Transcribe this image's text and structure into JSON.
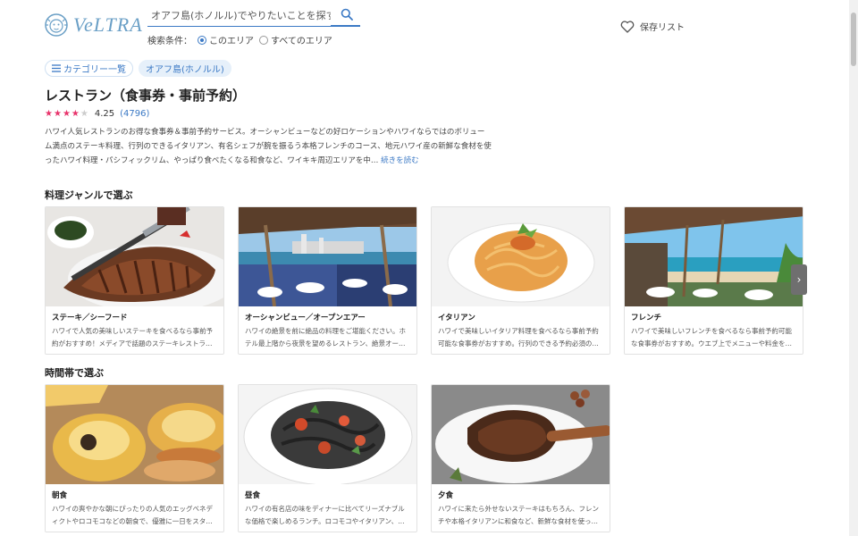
{
  "header": {
    "logo_text": "VeLTRA",
    "search_placeholder": "オアフ島(ホノルル)でやりたいことを探す",
    "search_condition_label": "検索条件：",
    "radio_this_area": "このエリア",
    "radio_all_areas": "すべてのエリア",
    "save_list_label": "保存リスト"
  },
  "chips": {
    "category_list": "カテゴリー一覧",
    "area": "オアフ島(ホノルル)"
  },
  "page": {
    "title": "レストラン（食事券・事前予約）",
    "rating_value": "4.25",
    "rating_stars": 4.25,
    "rating_count": "(4796)",
    "description": "ハワイ人気レストランのお得な食事券＆事前予約サービス。オーシャンビューなどの好ロケーションやハワイならではのボリューム満点のステーキ料理、行列のできるイタリアン、有名シェフが腕を振るう本格フレンチのコース、地元ハワイ産の新鮮な食材を使ったハワイ料理・パシフィックリム、やっぱり食べたくなる和食など、ワイキキ周辺エリアを中…",
    "read_more": "続きを読む"
  },
  "sections": {
    "cuisine_title": "料理ジャンルで選ぶ",
    "time_title": "時間帯で選ぶ"
  },
  "cuisine_cards": [
    {
      "title": "ステーキ／シーフード",
      "desc": "ハワイで人気の美味しいステーキを食べるなら事前予約がおすすめ！メディアで話題のステーキレストラ…"
    },
    {
      "title": "オーシャンビュー／オープンエアー",
      "desc": "ハワイの絶景を前に絶品の料理をご堪能ください。ホテル最上階から夜景を望めるレストラン、絶景オー…"
    },
    {
      "title": "イタリアン",
      "desc": "ハワイで美味しいイタリア料理を食べるなら事前予約可能な食事券がおすすめ。行列のできる予約必須の…"
    },
    {
      "title": "フレンチ",
      "desc": "ハワイで美味しいフレンチを食べるなら事前予約可能な食事券がおすすめ。ウエブ上でメニューや料金を…"
    }
  ],
  "time_cards": [
    {
      "title": "朝食",
      "desc": "ハワイの爽やかな朝にぴったりの人気のエッグベネディクトやロコモコなどの朝食で、優雅に一日をスタ…"
    },
    {
      "title": "昼食",
      "desc": "ハワイの有名店の味をディナーに比べてリーズナブルな価格で楽しめるランチ。ロコモコやイタリアン、…"
    },
    {
      "title": "夕食",
      "desc": "ハワイに来たら外せないステーキはもちろん、フレンチや本格イタリアンに和食など、新鮮な食材を使っ…"
    }
  ],
  "colors": {
    "accent": "#3b79c5",
    "star": "#e8336b"
  }
}
